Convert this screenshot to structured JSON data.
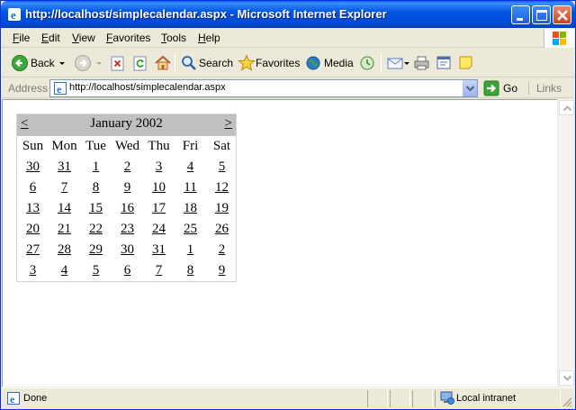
{
  "window": {
    "title": "http://localhost/simplecalendar.aspx - Microsoft Internet Explorer"
  },
  "menu": [
    "File",
    "Edit",
    "View",
    "Favorites",
    "Tools",
    "Help"
  ],
  "toolbar": {
    "back": "Back",
    "search": "Search",
    "favorites": "Favorites",
    "media": "Media"
  },
  "address": {
    "label": "Address",
    "url": "http://localhost/simplecalendar.aspx",
    "go": "Go",
    "links": "Links"
  },
  "calendar": {
    "prev": "<",
    "next": ">",
    "month": "January 2002",
    "weekdays": [
      "Sun",
      "Mon",
      "Tue",
      "Wed",
      "Thu",
      "Fri",
      "Sat"
    ],
    "weeks": [
      [
        "30",
        "31",
        "1",
        "2",
        "3",
        "4",
        "5"
      ],
      [
        "6",
        "7",
        "8",
        "9",
        "10",
        "11",
        "12"
      ],
      [
        "13",
        "14",
        "15",
        "16",
        "17",
        "18",
        "19"
      ],
      [
        "20",
        "21",
        "22",
        "23",
        "24",
        "25",
        "26"
      ],
      [
        "27",
        "28",
        "29",
        "30",
        "31",
        "1",
        "2"
      ],
      [
        "3",
        "4",
        "5",
        "6",
        "7",
        "8",
        "9"
      ]
    ]
  },
  "status": {
    "text": "Done",
    "zone": "Local intranet"
  },
  "colors": {
    "title_bar": "#0055E5",
    "calendar_header": "#C0C0C0",
    "chrome": "#ECE9D8"
  }
}
